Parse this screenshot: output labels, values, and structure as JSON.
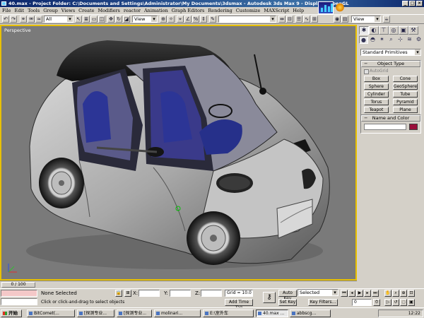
{
  "window": {
    "title": "40.max  - Project Folder: C:\\Documents and Settings\\Administrator\\My Documents\\3dsmax  - Autodesk 3ds Max 9     - Display : OpenGL"
  },
  "menu": [
    "File",
    "Edit",
    "Tools",
    "Group",
    "Views",
    "Create",
    "Modifiers",
    "reactor",
    "Animation",
    "Graph Editors",
    "Rendering",
    "Customize",
    "MAXScript",
    "Help"
  ],
  "toolbar": {
    "selection_filter": "All",
    "ref_coord": "View",
    "named_selection": "",
    "view_label": "View"
  },
  "viewport": {
    "label": "Perspective",
    "accent_color": "#e8c000"
  },
  "command_panel": {
    "tabs": [
      "create-tab",
      "modify-tab",
      "hierarchy-tab",
      "motion-tab",
      "display-tab",
      "utilities-tab"
    ],
    "category_dropdown": "Standard Primitives",
    "object_type": {
      "title": "Object Type",
      "autogrid": "AutoGrid",
      "buttons": [
        "Box",
        "Cone",
        "Sphere",
        "GeoSphere",
        "Cylinder",
        "Tube",
        "Torus",
        "Pyramid",
        "Teapot",
        "Plane"
      ]
    },
    "name_and_color": {
      "title": "Name and Color",
      "name_value": "",
      "swatch_color": "#9a0d3a"
    }
  },
  "timeline": {
    "slider_label": "0 / 100"
  },
  "status": {
    "selection": "None Selected",
    "prompt": "Click or click-and-drag to select objects",
    "x_label": "X:",
    "y_label": "Y:",
    "z_label": "Z:",
    "grid": "Grid = 10.0",
    "add_time_tag": "Add Time Tag",
    "auto_key": "Auto Key",
    "set_key": "Set Key",
    "key_mode": "Selected",
    "key_filters": "Key Filters...",
    "frame": "0"
  },
  "taskbar": {
    "start": "开始",
    "tasks": [
      "BitComet(...",
      "[探测专业...",
      "[探测专业...",
      "molinari...",
      "E:\\室外车",
      "40.max ...",
      "abbscg..."
    ],
    "clock": "12:22"
  }
}
